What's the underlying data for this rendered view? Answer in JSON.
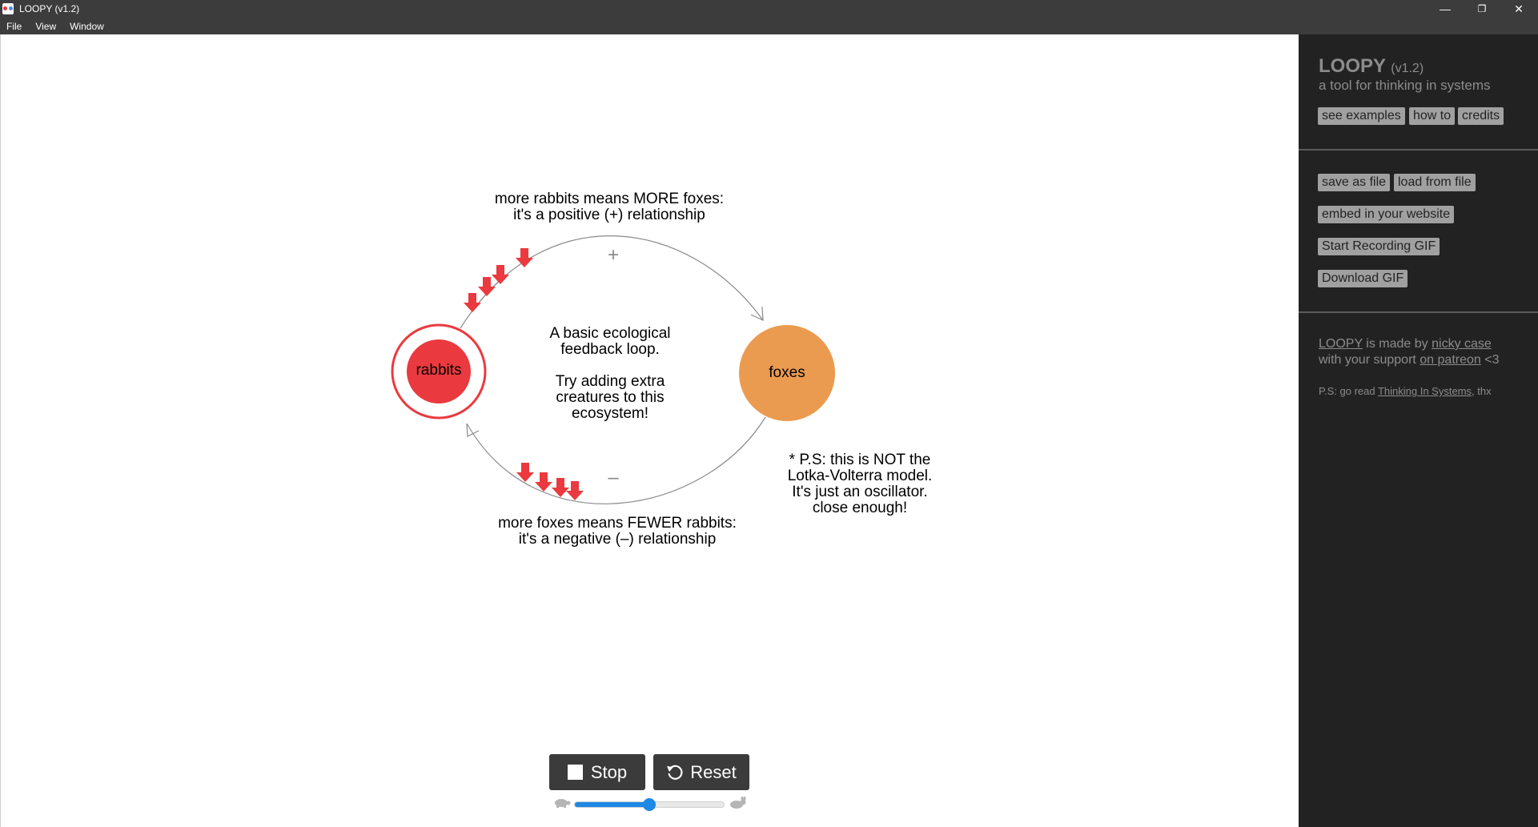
{
  "window": {
    "title": "LOOPY (v1.2)",
    "controls": {
      "minimize": "—",
      "restore": "❐",
      "close": "✕"
    }
  },
  "menu": [
    "File",
    "View",
    "Window"
  ],
  "canvas": {
    "nodes": {
      "rabbits": "rabbits",
      "foxes": "foxes"
    },
    "edges": {
      "positive_sign": "+",
      "negative_sign": "–"
    },
    "labels": {
      "top": "more rabbits means MORE foxes:\nit's a positive (+) relationship",
      "center": "A basic ecological\nfeedback loop.\n\nTry adding extra\ncreatures to this\necosystem!",
      "bottom": "more foxes means FEWER rabbits:\nit's a negative (–) relationship",
      "note": "* P.S: this is NOT the\nLotka-Volterra model.\nIt's just an oscillator.\nclose enough!"
    },
    "colors": {
      "rabbits": "#ea3a3f",
      "foxes": "#eb9b4f",
      "signals": "#ea3a3f"
    }
  },
  "controls": {
    "stop_label": "Stop",
    "reset_label": "Reset",
    "speed": 0.5
  },
  "sidebar": {
    "app_name": "LOOPY",
    "version": "(v1.2)",
    "tagline": "a tool for thinking in systems",
    "nav_buttons": [
      "see examples",
      "how to",
      "credits"
    ],
    "file_buttons": {
      "save": "save as file",
      "load": "load from file",
      "embed": "embed in your website",
      "record": "Start Recording GIF",
      "download": "Download GIF"
    },
    "credits": {
      "loopy_link": "LOOPY",
      "made_by": " is made by ",
      "author_link": "nicky case",
      "support_text": "with your support ",
      "patreon_link": "on patreon",
      "heart": " <3"
    },
    "ps": {
      "prefix": "P.S: go read ",
      "book_link": "Thinking In Systems",
      "suffix": ", thx"
    }
  }
}
